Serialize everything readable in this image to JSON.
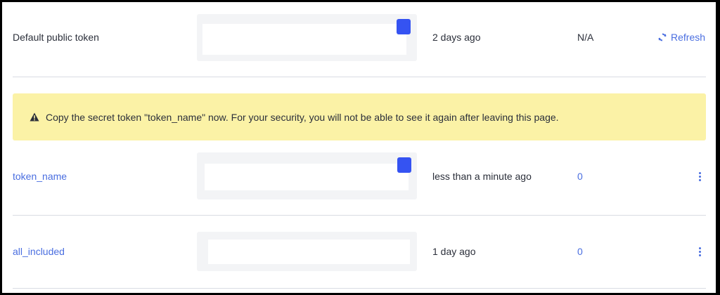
{
  "rows": [
    {
      "name": "Default public token",
      "created": "2 days ago",
      "uses": "N/A",
      "action": "Refresh"
    },
    {
      "name": "token_name",
      "created": "less than a minute ago",
      "uses": "0"
    },
    {
      "name": "all_included",
      "created": "1 day ago",
      "uses": "0"
    }
  ],
  "warning": {
    "text": "Copy the secret token \"token_name\" now. For your security, you will not be able to see it again after leaving this page."
  },
  "icons": {
    "refresh": "refresh-icon",
    "warning": "warning-triangle-icon",
    "more": "kebab-menu-icon",
    "copy": "copy-icon"
  },
  "colors": {
    "link": "#4a6ee0",
    "warning_bg": "#fbf2a6",
    "copy_button": "#3553f2"
  }
}
